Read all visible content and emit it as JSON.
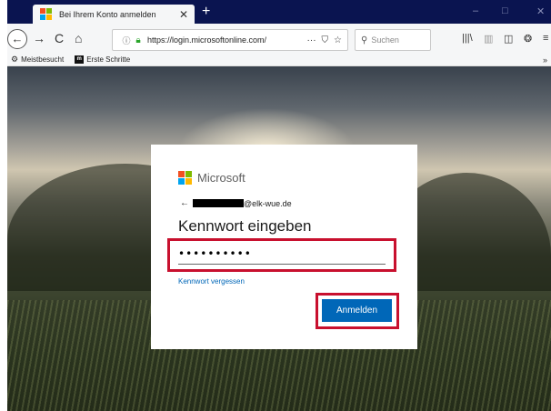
{
  "browser": {
    "tab_title": "Bei Ihrem Konto anmelden",
    "tab_close": "✕",
    "new_tab": "+",
    "window_controls": {
      "minimize": "–",
      "maximize": "□",
      "close": "✕"
    },
    "nav": {
      "back": "←",
      "forward": "→",
      "reload": "C",
      "home": "⌂"
    },
    "url": "https://login.microsoftonline.com/",
    "url_tools": {
      "more": "···",
      "pocket": "⛉",
      "bookmark": "☆"
    },
    "search_placeholder": "Suchen",
    "toolbar_icons": {
      "library": "|||\\",
      "sidebar": "▥",
      "reader": "◫",
      "extension": "❂",
      "menu": "≡"
    },
    "bookmarks": [
      {
        "label": "Meistbesucht",
        "icon": "gear-icon"
      },
      {
        "label": "Erste Schritte",
        "icon": "m-icon"
      }
    ],
    "bookmarks_more": "»"
  },
  "login": {
    "brand": "Microsoft",
    "logo_colors": [
      "#f25022",
      "#7fba00",
      "#00a4ef",
      "#ffb900"
    ],
    "back_arrow": "←",
    "email_suffix": "@elk-wue.de",
    "heading": "Kennwort eingeben",
    "password_value": "••••••••••",
    "forgot_link": "Kennwort vergessen",
    "submit_label": "Anmelden"
  },
  "colors": {
    "titlebar": "#0a1450",
    "highlight": "#c8102e",
    "accent": "#0067b8"
  }
}
